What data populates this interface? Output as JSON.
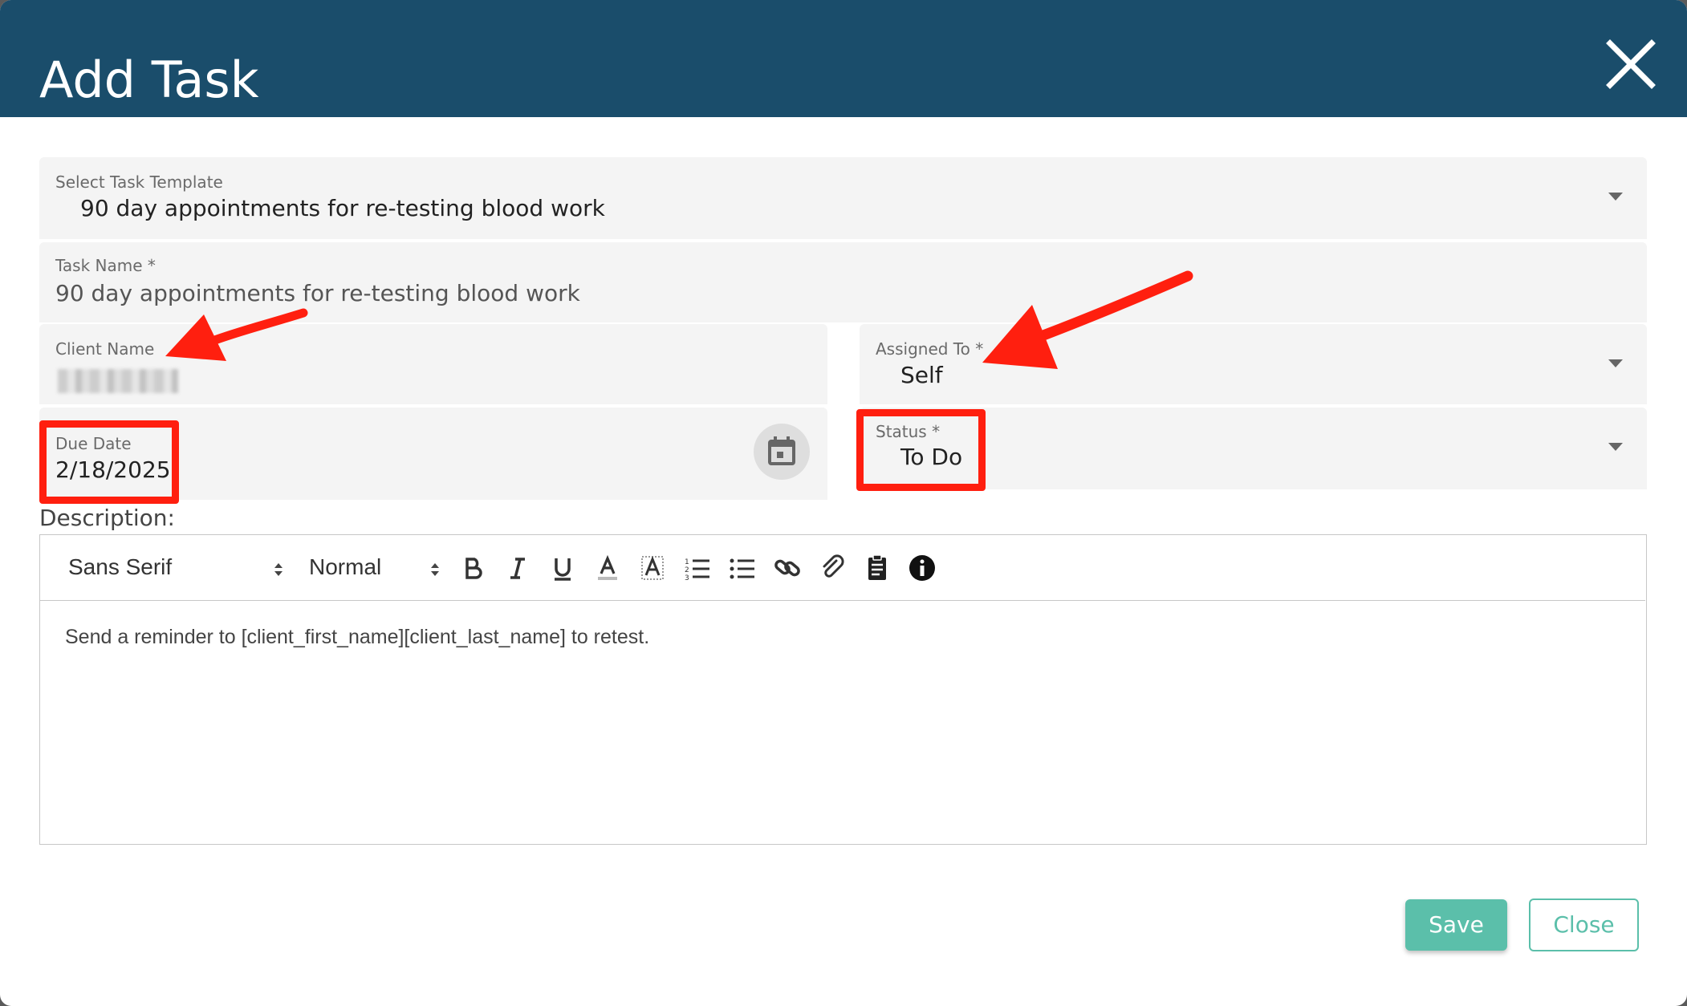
{
  "header": {
    "title": "Add Task"
  },
  "fields": {
    "template": {
      "label": "Select Task Template",
      "value": "90 day appointments for re-testing blood work"
    },
    "task_name": {
      "label": "Task Name *",
      "value": "90 day appointments for re-testing blood work"
    },
    "client_name": {
      "label": "Client Name"
    },
    "assigned_to": {
      "label": "Assigned To *",
      "value": "Self"
    },
    "due_date": {
      "label": "Due Date",
      "value": "2/18/2025"
    },
    "status": {
      "label": "Status *",
      "value": "To Do"
    }
  },
  "description": {
    "label": "Description:",
    "font_family": "Sans Serif",
    "font_size": "Normal",
    "body": "Send a reminder to [client_first_name][client_last_name] to retest."
  },
  "icons": [
    "close-icon",
    "dropdown-arrow-icon",
    "calendar-icon",
    "bold-icon",
    "italic-icon",
    "underline-icon",
    "text-color-icon",
    "background-color-icon",
    "ordered-list-icon",
    "bullet-list-icon",
    "link-icon",
    "attachment-icon",
    "clipboard-icon",
    "info-icon"
  ],
  "footer": {
    "save_label": "Save",
    "close_label": "Close"
  },
  "colors": {
    "header_bg": "#1a4d6b",
    "accent": "#5bbfaa",
    "annotation": "#ff1f0f"
  }
}
